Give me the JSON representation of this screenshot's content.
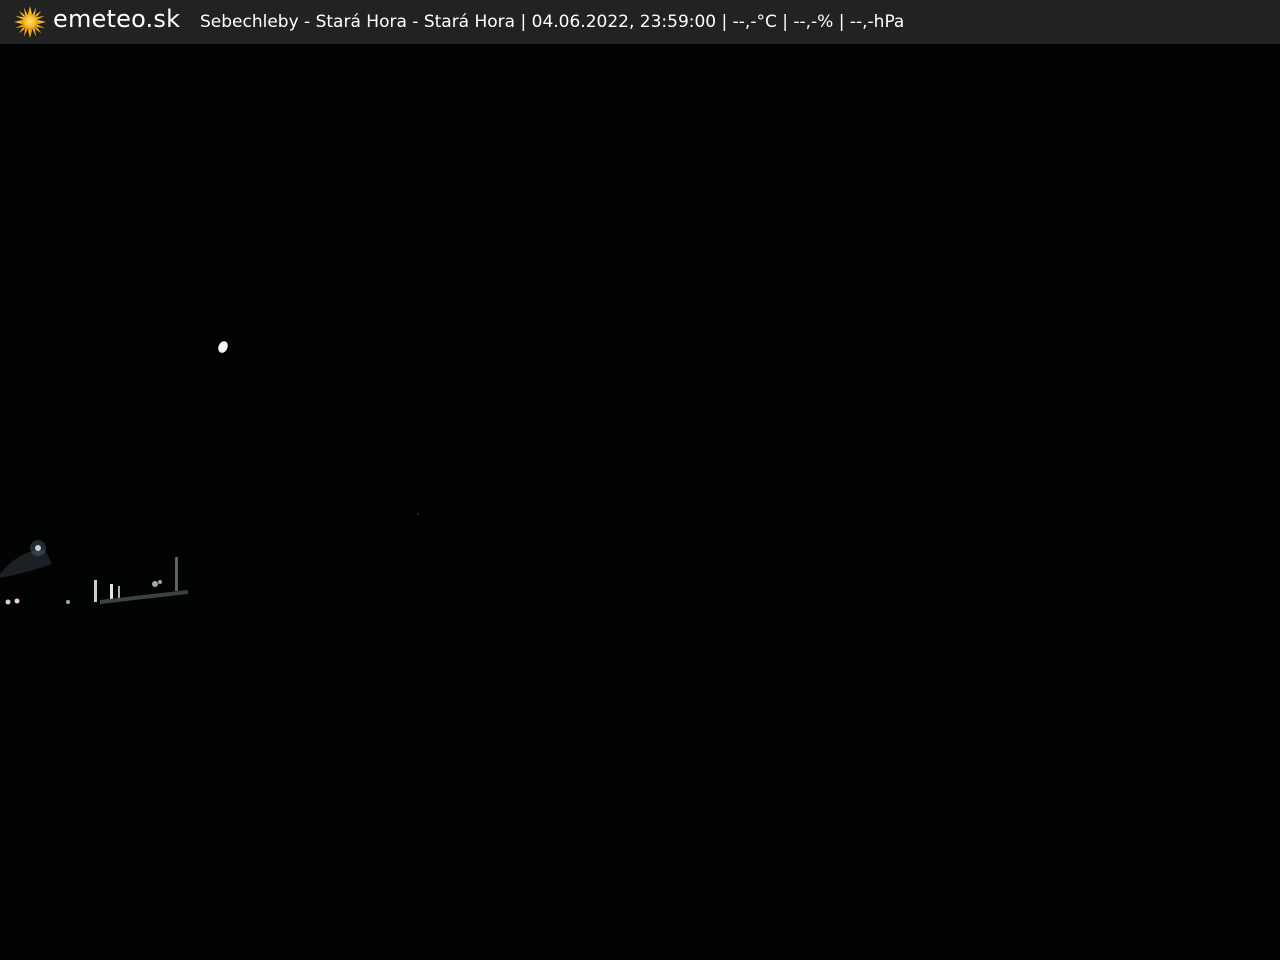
{
  "brand": {
    "logo_icon": "sun-icon",
    "name": "emeteo.sk",
    "accent_color": "#f5b21e"
  },
  "caption": {
    "text": "Sebechleby - Stará Hora - Stará Hora | 04.06.2022, 23:59:00 | --,-°C | --,-% | --,-hPa"
  },
  "scene": {
    "description_colors": {
      "sky": "#020303",
      "lights": "#ffffff"
    }
  }
}
